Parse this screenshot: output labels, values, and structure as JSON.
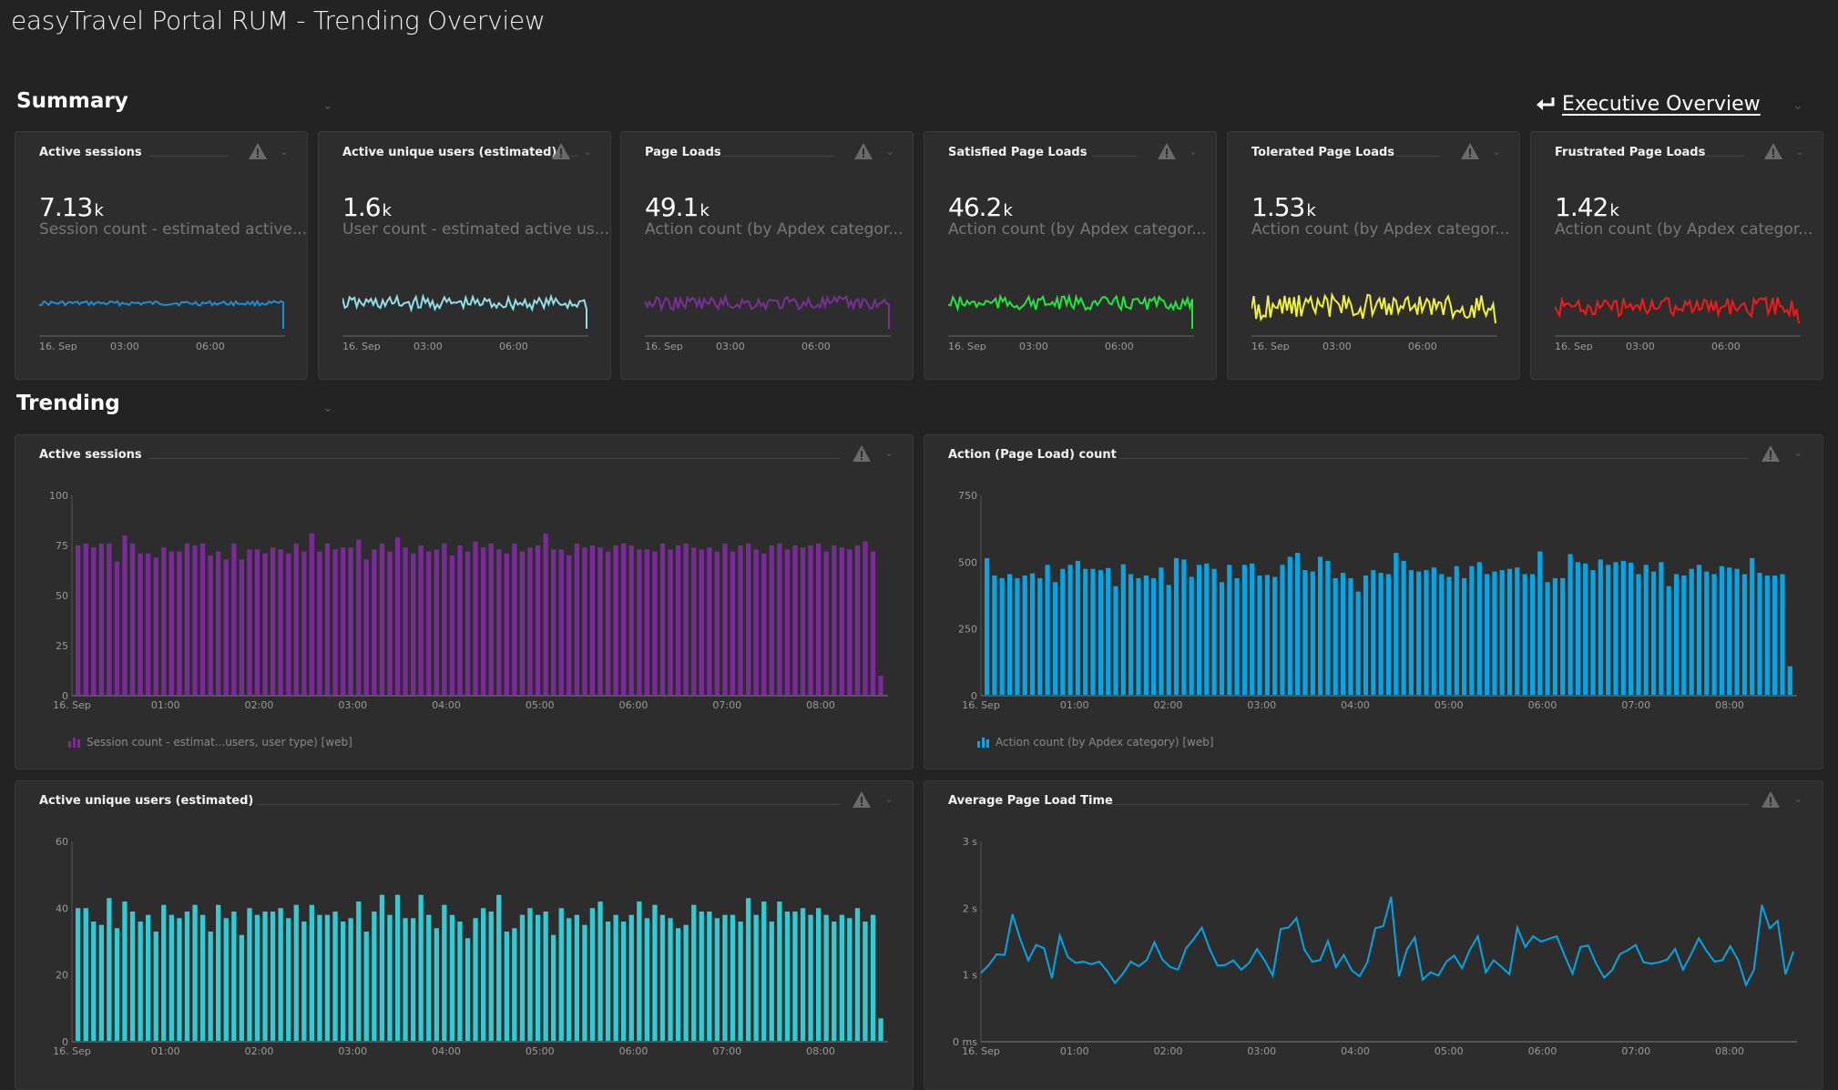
{
  "page": {
    "title": "easyTravel Portal RUM - Trending Overview"
  },
  "sections": {
    "summary": "Summary",
    "trending": "Trending",
    "executive_link": "Executive Overview"
  },
  "summary_tiles": [
    {
      "title": "Active sessions",
      "value": "7.13",
      "unit": "k",
      "subtitle": "Session count - estimated active...",
      "color": "#1a8fd8",
      "xticks": [
        "16. Sep",
        "03:00",
        "06:00"
      ]
    },
    {
      "title": "Active unique users (estimated)",
      "value": "1.6",
      "unit": "k",
      "subtitle": "User count - estimated active us...",
      "color": "#8fe0e8",
      "xticks": [
        "16. Sep",
        "03:00",
        "06:00"
      ]
    },
    {
      "title": "Page Loads",
      "value": "49.1",
      "unit": "k",
      "subtitle": "Action count (by Apdex categor...",
      "color": "#7a2f99",
      "xticks": [
        "16. Sep",
        "03:00",
        "06:00"
      ]
    },
    {
      "title": "Satisfied Page Loads",
      "value": "46.2",
      "unit": "k",
      "subtitle": "Action count (by Apdex categor...",
      "color": "#22e63c",
      "xticks": [
        "16. Sep",
        "03:00",
        "06:00"
      ]
    },
    {
      "title": "Tolerated Page Loads",
      "value": "1.53",
      "unit": "k",
      "subtitle": "Action count (by Apdex categor...",
      "color": "#f2f23a",
      "xticks": [
        "16. Sep",
        "03:00",
        "06:00"
      ]
    },
    {
      "title": "Frustrated Page Loads",
      "value": "1.42",
      "unit": "k",
      "subtitle": "Action count (by Apdex categor...",
      "color": "#f21a1a",
      "xticks": [
        "16. Sep",
        "03:00",
        "06:00"
      ]
    }
  ],
  "chart_data": [
    {
      "type": "bar",
      "title": "Active sessions",
      "color": "#7b2a9a",
      "legend": "Session count - estimat...users, user type) [web]",
      "xlabels": [
        "16. Sep",
        "01:00",
        "02:00",
        "03:00",
        "04:00",
        "05:00",
        "06:00",
        "07:00",
        "08:00"
      ],
      "yticks": [
        "0",
        "25",
        "50",
        "75",
        "100"
      ],
      "ylim": [
        0,
        100
      ],
      "values": [
        75,
        76,
        74,
        76,
        76,
        67,
        80,
        76,
        71,
        71,
        69,
        74,
        72,
        72,
        76,
        75,
        76,
        70,
        72,
        68,
        76,
        68,
        73,
        73,
        71,
        74,
        73,
        71,
        76,
        72,
        81,
        72,
        76,
        73,
        74,
        74,
        78,
        68,
        73,
        76,
        72,
        79,
        74,
        71,
        75,
        72,
        73,
        76,
        70,
        75,
        72,
        77,
        74,
        76,
        73,
        71,
        76,
        72,
        74,
        75,
        81,
        73,
        73,
        70,
        76,
        74,
        75,
        74,
        72,
        75,
        76,
        75,
        73,
        73,
        72,
        76,
        73,
        75,
        76,
        74,
        73,
        74,
        72,
        76,
        72,
        75,
        76,
        73,
        71,
        75,
        76,
        73,
        75,
        74,
        75,
        76,
        72,
        75,
        74,
        73,
        75,
        77,
        72,
        10
      ]
    },
    {
      "type": "bar",
      "title": "Action (Page Load) count",
      "color": "#00a6e6",
      "legend": "Action count (by Apdex category) [web]",
      "xlabels": [
        "16. Sep",
        "01:00",
        "02:00",
        "03:00",
        "04:00",
        "05:00",
        "06:00",
        "07:00",
        "08:00"
      ],
      "yticks": [
        "0",
        "250",
        "500",
        "750"
      ],
      "ylim": [
        0,
        750
      ],
      "values": [
        515,
        450,
        440,
        455,
        440,
        450,
        458,
        440,
        490,
        425,
        475,
        490,
        505,
        475,
        475,
        470,
        478,
        410,
        492,
        455,
        440,
        450,
        440,
        480,
        415,
        515,
        510,
        445,
        490,
        495,
        475,
        425,
        490,
        440,
        490,
        495,
        450,
        452,
        445,
        490,
        520,
        535,
        470,
        465,
        520,
        505,
        440,
        460,
        440,
        390,
        450,
        470,
        460,
        455,
        535,
        505,
        470,
        465,
        470,
        480,
        455,
        445,
        485,
        440,
        485,
        500,
        455,
        465,
        470,
        475,
        480,
        455,
        455,
        540,
        425,
        440,
        440,
        530,
        500,
        495,
        470,
        510,
        490,
        500,
        505,
        498,
        455,
        490,
        465,
        500,
        410,
        455,
        450,
        475,
        490,
        465,
        455,
        485,
        480,
        475,
        455,
        515,
        460,
        450,
        450,
        455,
        110
      ]
    },
    {
      "type": "bar",
      "title": "Active unique users (estimated)",
      "color": "#2ecdd6",
      "legend": "",
      "xlabels": [
        "16. Sep",
        "01:00",
        "02:00",
        "03:00",
        "04:00",
        "05:00",
        "06:00",
        "07:00",
        "08:00"
      ],
      "yticks": [
        "0",
        "20",
        "40",
        "60"
      ],
      "ylim": [
        0,
        60
      ],
      "values": [
        40,
        40,
        36,
        35,
        43,
        34,
        42,
        39,
        36,
        38,
        33,
        41,
        38,
        37,
        39,
        41,
        38,
        33,
        41,
        37,
        39,
        32,
        40,
        38,
        39,
        39,
        40,
        37,
        41,
        36,
        41,
        38,
        38,
        39,
        36,
        37,
        42,
        33,
        39,
        44,
        38,
        44,
        37,
        37,
        44,
        38,
        34,
        41,
        38,
        36,
        31,
        37,
        40,
        39,
        44,
        33,
        34,
        38,
        40,
        38,
        39,
        32,
        40,
        37,
        38,
        35,
        40,
        42,
        36,
        38,
        36,
        38,
        42,
        37,
        41,
        38,
        37,
        34,
        35,
        41,
        39,
        39,
        37,
        38,
        38,
        36,
        43,
        38,
        42,
        36,
        42,
        39,
        39,
        40,
        38,
        40,
        38,
        36,
        38,
        37,
        40,
        36,
        38,
        7
      ]
    },
    {
      "type": "line",
      "title": "Average Page Load Time",
      "color": "#00a6e6",
      "legend": "",
      "xlabels": [
        "16. Sep",
        "01:00",
        "02:00",
        "03:00",
        "04:00",
        "05:00",
        "06:00",
        "07:00",
        "08:00"
      ],
      "yticks": [
        "0 ms",
        "1 s",
        "2 s",
        "3 s"
      ],
      "ylim": [
        0,
        3
      ],
      "unit": "s",
      "values": [
        1.03,
        1.15,
        1.31,
        1.3,
        1.91,
        1.53,
        1.22,
        1.45,
        1.4,
        0.95,
        1.59,
        1.27,
        1.18,
        1.2,
        1.16,
        1.2,
        1.06,
        0.88,
        1.02,
        1.2,
        1.13,
        1.22,
        1.49,
        1.23,
        1.12,
        1.08,
        1.4,
        1.54,
        1.71,
        1.39,
        1.14,
        1.15,
        1.22,
        1.08,
        1.18,
        1.39,
        1.21,
        0.99,
        1.69,
        1.71,
        1.85,
        1.38,
        1.2,
        1.22,
        1.51,
        1.12,
        1.3,
        1.07,
        0.98,
        1.19,
        1.7,
        1.73,
        2.17,
        0.98,
        1.38,
        1.56,
        0.93,
        1.04,
        0.99,
        1.2,
        1.29,
        1.1,
        1.38,
        1.58,
        1.04,
        1.22,
        1.12,
        1.01,
        1.71,
        1.42,
        1.58,
        1.5,
        1.54,
        1.58,
        1.29,
        1.02,
        1.42,
        1.44,
        1.17,
        0.96,
        1.07,
        1.31,
        1.37,
        1.45,
        1.19,
        1.17,
        1.19,
        1.23,
        1.39,
        1.08,
        1.3,
        1.55,
        1.36,
        1.2,
        1.22,
        1.43,
        1.22,
        0.85,
        1.08,
        2.05,
        1.7,
        1.81,
        1.01,
        1.35
      ]
    }
  ]
}
